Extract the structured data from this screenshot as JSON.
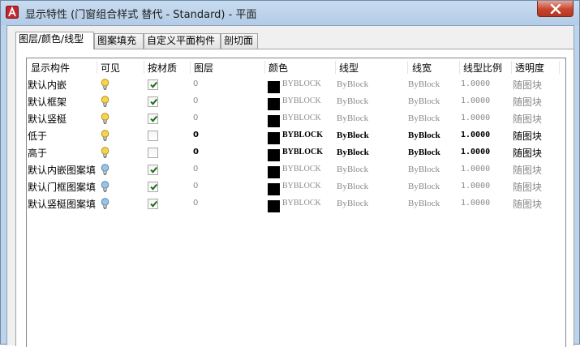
{
  "window": {
    "title": "显示特性 (门窗组合样式 替代 - Standard) - 平面",
    "close_icon": "close-icon",
    "accent": "#c7452f"
  },
  "tabs": [
    {
      "label": "图层/颜色/线型",
      "active": true
    },
    {
      "label": "图案填充",
      "active": false
    },
    {
      "label": "自定义平面构件",
      "active": false
    },
    {
      "label": "剖切面",
      "active": false
    }
  ],
  "table": {
    "headers": [
      "显示构件",
      "可见",
      "按材质",
      "图层",
      "颜色",
      "线型",
      "线宽",
      "线型比例",
      "透明度"
    ],
    "rows": [
      {
        "name": "默认内嵌",
        "visible": true,
        "bulb": "yellow",
        "by_material": true,
        "layer": "0",
        "color": "BYBLOCK",
        "linetype": "ByBlock",
        "lineweight": "ByBlock",
        "scale": "1.0000",
        "transparency": "随图块",
        "style": "dim"
      },
      {
        "name": "默认框架",
        "visible": true,
        "bulb": "yellow",
        "by_material": true,
        "layer": "0",
        "color": "BYBLOCK",
        "linetype": "ByBlock",
        "lineweight": "ByBlock",
        "scale": "1.0000",
        "transparency": "随图块",
        "style": "dim"
      },
      {
        "name": "默认竖梃",
        "visible": true,
        "bulb": "yellow",
        "by_material": true,
        "layer": "0",
        "color": "BYBLOCK",
        "linetype": "ByBlock",
        "lineweight": "ByBlock",
        "scale": "1.0000",
        "transparency": "随图块",
        "style": "dim"
      },
      {
        "name": "低于",
        "visible": true,
        "bulb": "yellow",
        "by_material": false,
        "layer": "0",
        "color": "BYBLOCK",
        "linetype": "ByBlock",
        "lineweight": "ByBlock",
        "scale": "1.0000",
        "transparency": "随图块",
        "style": "bold"
      },
      {
        "name": "高于",
        "visible": true,
        "bulb": "yellow",
        "by_material": false,
        "layer": "0",
        "color": "BYBLOCK",
        "linetype": "ByBlock",
        "lineweight": "ByBlock",
        "scale": "1.0000",
        "transparency": "随图块",
        "style": "bold"
      },
      {
        "name": "默认内嵌图案填",
        "visible": false,
        "bulb": "blue",
        "by_material": true,
        "layer": "0",
        "color": "BYBLOCK",
        "linetype": "ByBlock",
        "lineweight": "ByBlock",
        "scale": "1.0000",
        "transparency": "随图块",
        "style": "dim"
      },
      {
        "name": "默认门框图案填",
        "visible": false,
        "bulb": "blue",
        "by_material": true,
        "layer": "0",
        "color": "BYBLOCK",
        "linetype": "ByBlock",
        "lineweight": "ByBlock",
        "scale": "1.0000",
        "transparency": "随图块",
        "style": "dim"
      },
      {
        "name": "默认竖梃图案填",
        "visible": false,
        "bulb": "blue",
        "by_material": true,
        "layer": "0",
        "color": "BYBLOCK",
        "linetype": "ByBlock",
        "lineweight": "ByBlock",
        "scale": "1.0000",
        "transparency": "随图块",
        "style": "dim"
      }
    ]
  }
}
